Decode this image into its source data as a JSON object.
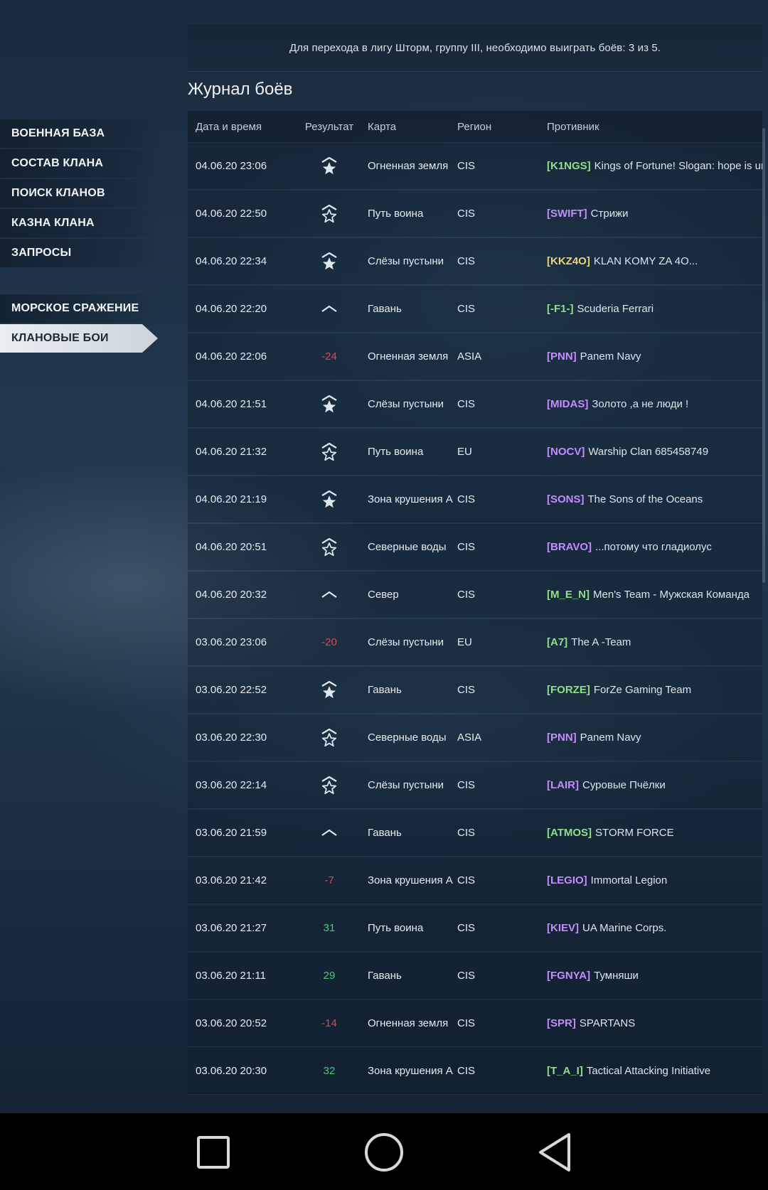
{
  "notice": "Для перехода в лигу Шторм, группу III, необходимо выиграть боёв: 3 из 5.",
  "section_title": "Журнал боёв",
  "sidebar": {
    "group1": [
      "ВОЕННАЯ БАЗА",
      "СОСТАВ КЛАНА",
      "ПОИСК КЛАНОВ",
      "КАЗНА КЛАНА",
      "ЗАПРОСЫ"
    ],
    "group2": [
      "МОРСКОЕ СРАЖЕНИЕ",
      "КЛАНОВЫЕ БОИ"
    ],
    "active": "КЛАНОВЫЕ БОИ"
  },
  "table": {
    "headers": {
      "date": "Дата и время",
      "result": "Результат",
      "map": "Карта",
      "region": "Регион",
      "opponent": "Противник"
    },
    "rows": [
      {
        "date": "04.06.20 23:06",
        "result_icon": "star-filled-icon",
        "map": "Огненная земля",
        "region": "CIS",
        "tag": "[K1NGS]",
        "tag_color": "#8fe08a",
        "name": "Kings of Fortune! Slogan: hope is un"
      },
      {
        "date": "04.06.20 22:50",
        "result_icon": "star-outline-icon",
        "map": "Путь воина",
        "region": "CIS",
        "tag": "[SWIFT]",
        "tag_color": "#c58bff",
        "name": "Стрижи"
      },
      {
        "date": "04.06.20 22:34",
        "result_icon": "star-filled-icon",
        "map": "Слёзы пустыни",
        "region": "CIS",
        "tag": "[KKZ4O]",
        "tag_color": "#e8d27a",
        "name": "KLAN KOMY ZA 4O..."
      },
      {
        "date": "04.06.20 22:20",
        "result_icon": "chevron-up-icon",
        "map": "Гавань",
        "region": "CIS",
        "tag": "[-F1-]",
        "tag_color": "#8fe08a",
        "name": "Scuderia Ferrari"
      },
      {
        "date": "04.06.20 22:06",
        "result_text": "-24",
        "result_color": "#e0464c",
        "map": "Огненная земля",
        "region": "ASIA",
        "tag": "[PNN]",
        "tag_color": "#c58bff",
        "name": "Panem Navy"
      },
      {
        "date": "04.06.20 21:51",
        "result_icon": "star-filled-icon",
        "map": "Слёзы пустыни",
        "region": "CIS",
        "tag": "[MIDAS]",
        "tag_color": "#c58bff",
        "name": "Золото ,а не люди !"
      },
      {
        "date": "04.06.20 21:32",
        "result_icon": "star-outline-icon",
        "map": "Путь воина",
        "region": "EU",
        "tag": "[NOCV]",
        "tag_color": "#c58bff",
        "name": "Warship Clan 685458749"
      },
      {
        "date": "04.06.20 21:19",
        "result_icon": "star-filled-icon",
        "map": "Зона крушения А",
        "region": "CIS",
        "tag": "[SONS]",
        "tag_color": "#c58bff",
        "name": "The Sons of the Oceans"
      },
      {
        "date": "04.06.20 20:51",
        "result_icon": "star-outline-icon",
        "map": "Северные воды",
        "region": "CIS",
        "tag": "[BRAVO]",
        "tag_color": "#c58bff",
        "name": "...потому что гладиолус"
      },
      {
        "date": "04.06.20 20:32",
        "result_icon": "chevron-up-icon",
        "map": "Север",
        "region": "CIS",
        "tag": "[M_E_N]",
        "tag_color": "#8fe08a",
        "name": "Men's Team - Мужская Команда"
      },
      {
        "date": "03.06.20 23:06",
        "result_text": "-20",
        "result_color": "#e0464c",
        "map": "Слёзы пустыни",
        "region": "EU",
        "tag": "[A7]",
        "tag_color": "#8fe08a",
        "name": "The A -Team"
      },
      {
        "date": "03.06.20 22:52",
        "result_icon": "star-filled-icon",
        "map": "Гавань",
        "region": "CIS",
        "tag": "[FORZE]",
        "tag_color": "#8fe08a",
        "name": "ForZe Gaming Team"
      },
      {
        "date": "03.06.20 22:30",
        "result_icon": "star-outline-icon",
        "map": "Северные воды",
        "region": "ASIA",
        "tag": "[PNN]",
        "tag_color": "#c58bff",
        "name": "Panem Navy"
      },
      {
        "date": "03.06.20 22:14",
        "result_icon": "star-outline-icon",
        "map": "Слёзы пустыни",
        "region": "CIS",
        "tag": "[LAIR]",
        "tag_color": "#c58bff",
        "name": "Суровые Пчёлки"
      },
      {
        "date": "03.06.20 21:59",
        "result_icon": "chevron-up-icon",
        "map": "Гавань",
        "region": "CIS",
        "tag": "[ATMOS]",
        "tag_color": "#8fe08a",
        "name": "STORM FORCE"
      },
      {
        "date": "03.06.20 21:42",
        "result_text": "-7",
        "result_color": "#e0464c",
        "map": "Зона крушения А",
        "region": "CIS",
        "tag": "[LEGIO]",
        "tag_color": "#c58bff",
        "name": "Immortal Legion"
      },
      {
        "date": "03.06.20 21:27",
        "result_text": "31",
        "result_color": "#3fcf75",
        "map": "Путь воина",
        "region": "CIS",
        "tag": "[KIEV]",
        "tag_color": "#c58bff",
        "name": "UA Marine Corps."
      },
      {
        "date": "03.06.20 21:11",
        "result_text": "29",
        "result_color": "#3fcf75",
        "map": "Гавань",
        "region": "CIS",
        "tag": "[FGNYA]",
        "tag_color": "#c58bff",
        "name": "Тумняши"
      },
      {
        "date": "03.06.20 20:52",
        "result_text": "-14",
        "result_color": "#e0464c",
        "map": "Огненная земля",
        "region": "CIS",
        "tag": "[SPR]",
        "tag_color": "#c58bff",
        "name": "SPARTANS"
      },
      {
        "date": "03.06.20 20:30",
        "result_text": "32",
        "result_color": "#3fcf75",
        "map": "Зона крушения А",
        "region": "CIS",
        "tag": "[T_A_I]",
        "tag_color": "#8fe08a",
        "name": "Tactical Attacking Initiative"
      }
    ]
  },
  "navbar": {
    "icons": [
      "recents-square-icon",
      "home-circle-icon",
      "back-triangle-icon"
    ]
  }
}
